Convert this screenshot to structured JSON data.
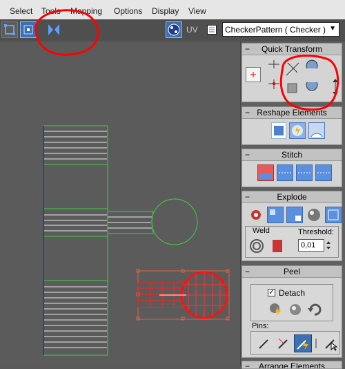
{
  "menu": {
    "items": [
      "Select",
      "Tools",
      "Mapping",
      "Options",
      "Display",
      "View"
    ]
  },
  "toolbar": {
    "uv_label": "UV",
    "texture_select": "CheckerPattern  ( Checker )"
  },
  "rollouts": {
    "quick_transform": {
      "title": "Quick Transform"
    },
    "reshape": {
      "title": "Reshape Elements"
    },
    "stitch": {
      "title": "Stitch"
    },
    "explode": {
      "title": "Explode",
      "weld_label": "Weld",
      "threshold_label": "Threshold:",
      "threshold_value": "0,01"
    },
    "peel": {
      "title": "Peel",
      "detach_label": "Detach",
      "detach_checked": true,
      "pins_label": "Pins:"
    },
    "arrange": {
      "title": "Arrange Elements"
    }
  },
  "colors": {
    "accent": "#3d6fb3",
    "annotation_red": "#ff0000",
    "uv_green": "#3fd13f",
    "uv_selected": "#e03020"
  },
  "icons": {
    "rollout_collapse": "−",
    "select_arrow": "▼",
    "checkbox_mark": "✓"
  }
}
